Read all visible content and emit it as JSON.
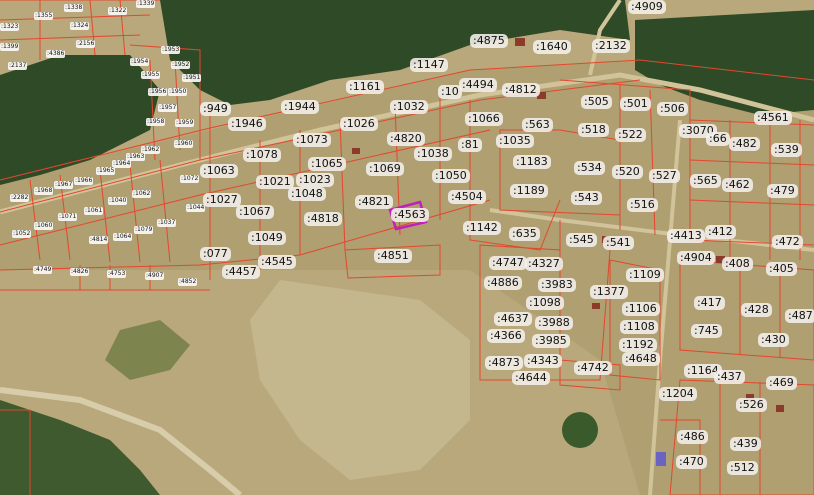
{
  "map": {
    "accent_parcel_color": "#c01fb8",
    "boundary_color": "#e4472e",
    "forest_color": "#2f4a26",
    "field_color": "#b9a87b",
    "selected_parcel": ":4563"
  },
  "labels": [
    {
      "t": ":4909"
    },
    {
      "t": ":4875"
    },
    {
      "t": ":1640"
    },
    {
      "t": ":2132"
    },
    {
      "t": ":1147"
    },
    {
      "t": ":1161"
    },
    {
      "t": ":4494"
    },
    {
      "t": ":10"
    },
    {
      "t": ":4812"
    },
    {
      "t": ":949"
    },
    {
      "t": ":1944"
    },
    {
      "t": ":1032"
    },
    {
      "t": ":505"
    },
    {
      "t": ":501"
    },
    {
      "t": ":506"
    },
    {
      "t": ":4561"
    },
    {
      "t": ":1946"
    },
    {
      "t": ":1026"
    },
    {
      "t": ":1066"
    },
    {
      "t": ":563"
    },
    {
      "t": ":518"
    },
    {
      "t": ":522"
    },
    {
      "t": ":3070"
    },
    {
      "t": ":66"
    },
    {
      "t": ":482"
    },
    {
      "t": ":539"
    },
    {
      "t": ":1073"
    },
    {
      "t": ":4820"
    },
    {
      "t": ":1035"
    },
    {
      "t": ":81"
    },
    {
      "t": ":1078"
    },
    {
      "t": ":1038"
    },
    {
      "t": ":1065"
    },
    {
      "t": ":1183"
    },
    {
      "t": ":534"
    },
    {
      "t": ":520"
    },
    {
      "t": ":527"
    },
    {
      "t": ":1063"
    },
    {
      "t": ":1069"
    },
    {
      "t": ":1023"
    },
    {
      "t": ":1050"
    },
    {
      "t": ":565"
    },
    {
      "t": ":462"
    },
    {
      "t": ":479"
    },
    {
      "t": ":1021"
    },
    {
      "t": ":1048"
    },
    {
      "t": ":1189"
    },
    {
      "t": ":543"
    },
    {
      "t": ":516"
    },
    {
      "t": ":1027"
    },
    {
      "t": ":4504"
    },
    {
      "t": ":4821"
    },
    {
      "t": ":1067"
    },
    {
      "t": ":4818"
    },
    {
      "t": ":4563"
    },
    {
      "t": ":1142"
    },
    {
      "t": ":635"
    },
    {
      "t": ":1049"
    },
    {
      "t": ":545"
    },
    {
      "t": ":541"
    },
    {
      "t": ":4413"
    },
    {
      "t": ":412"
    },
    {
      "t": ":472"
    },
    {
      "t": ":077"
    },
    {
      "t": ":4851"
    },
    {
      "t": ":4545"
    },
    {
      "t": ":4747"
    },
    {
      "t": ":4327"
    },
    {
      "t": ":4904"
    },
    {
      "t": ":408"
    },
    {
      "t": ":4457"
    },
    {
      "t": ":1109"
    },
    {
      "t": ":405"
    },
    {
      "t": ":4886"
    },
    {
      "t": ":3983"
    },
    {
      "t": ":1377"
    },
    {
      "t": ":1098"
    },
    {
      "t": ":417"
    },
    {
      "t": ":428"
    },
    {
      "t": ":487"
    },
    {
      "t": ":4637"
    },
    {
      "t": ":3988"
    },
    {
      "t": ":1106"
    },
    {
      "t": ":4366"
    },
    {
      "t": ":1108"
    },
    {
      "t": ":745"
    },
    {
      "t": ":3985"
    },
    {
      "t": ":1192"
    },
    {
      "t": ":430"
    },
    {
      "t": ":4343"
    },
    {
      "t": ":4648"
    },
    {
      "t": ":4873"
    },
    {
      "t": ":4742"
    },
    {
      "t": ":1164"
    },
    {
      "t": ":437"
    },
    {
      "t": ":469"
    },
    {
      "t": ":4644"
    },
    {
      "t": ":1204"
    },
    {
      "t": ":526"
    },
    {
      "t": ":486"
    },
    {
      "t": ":439"
    },
    {
      "t": ":470"
    },
    {
      "t": ":512"
    }
  ],
  "small_labels": [
    {
      "t": ":1355"
    },
    {
      "t": ":1338"
    },
    {
      "t": ":1339"
    },
    {
      "t": ":1324"
    },
    {
      "t": ":1322"
    },
    {
      "t": ":1323"
    },
    {
      "t": ":1399"
    },
    {
      "t": ":4386"
    },
    {
      "t": ":2156"
    },
    {
      "t": ":2137"
    },
    {
      "t": ":1953"
    },
    {
      "t": ":1954"
    },
    {
      "t": ":1952"
    },
    {
      "t": ":1955"
    },
    {
      "t": ":1951"
    },
    {
      "t": ":1956"
    },
    {
      "t": ":1950"
    },
    {
      "t": ":1957"
    },
    {
      "t": ":1959"
    },
    {
      "t": ":1958"
    },
    {
      "t": ":1962"
    },
    {
      "t": ":1960"
    },
    {
      "t": ":1963"
    },
    {
      "t": ":1964"
    },
    {
      "t": ":1965"
    },
    {
      "t": ":1966"
    },
    {
      "t": ":1967"
    },
    {
      "t": ":1968"
    },
    {
      "t": ":2282"
    },
    {
      "t": ":1071"
    },
    {
      "t": ":1072"
    },
    {
      "t": ":1061"
    },
    {
      "t": ":1062"
    },
    {
      "t": ":1040"
    },
    {
      "t": ":1044"
    },
    {
      "t": ":1052"
    },
    {
      "t": ":1060"
    },
    {
      "t": ":1037"
    },
    {
      "t": ":1079"
    },
    {
      "t": ":4814"
    },
    {
      "t": ":1064"
    },
    {
      "t": ":4749"
    },
    {
      "t": ":4826"
    },
    {
      "t": ":4753"
    },
    {
      "t": ":4907"
    },
    {
      "t": ":4852"
    }
  ]
}
